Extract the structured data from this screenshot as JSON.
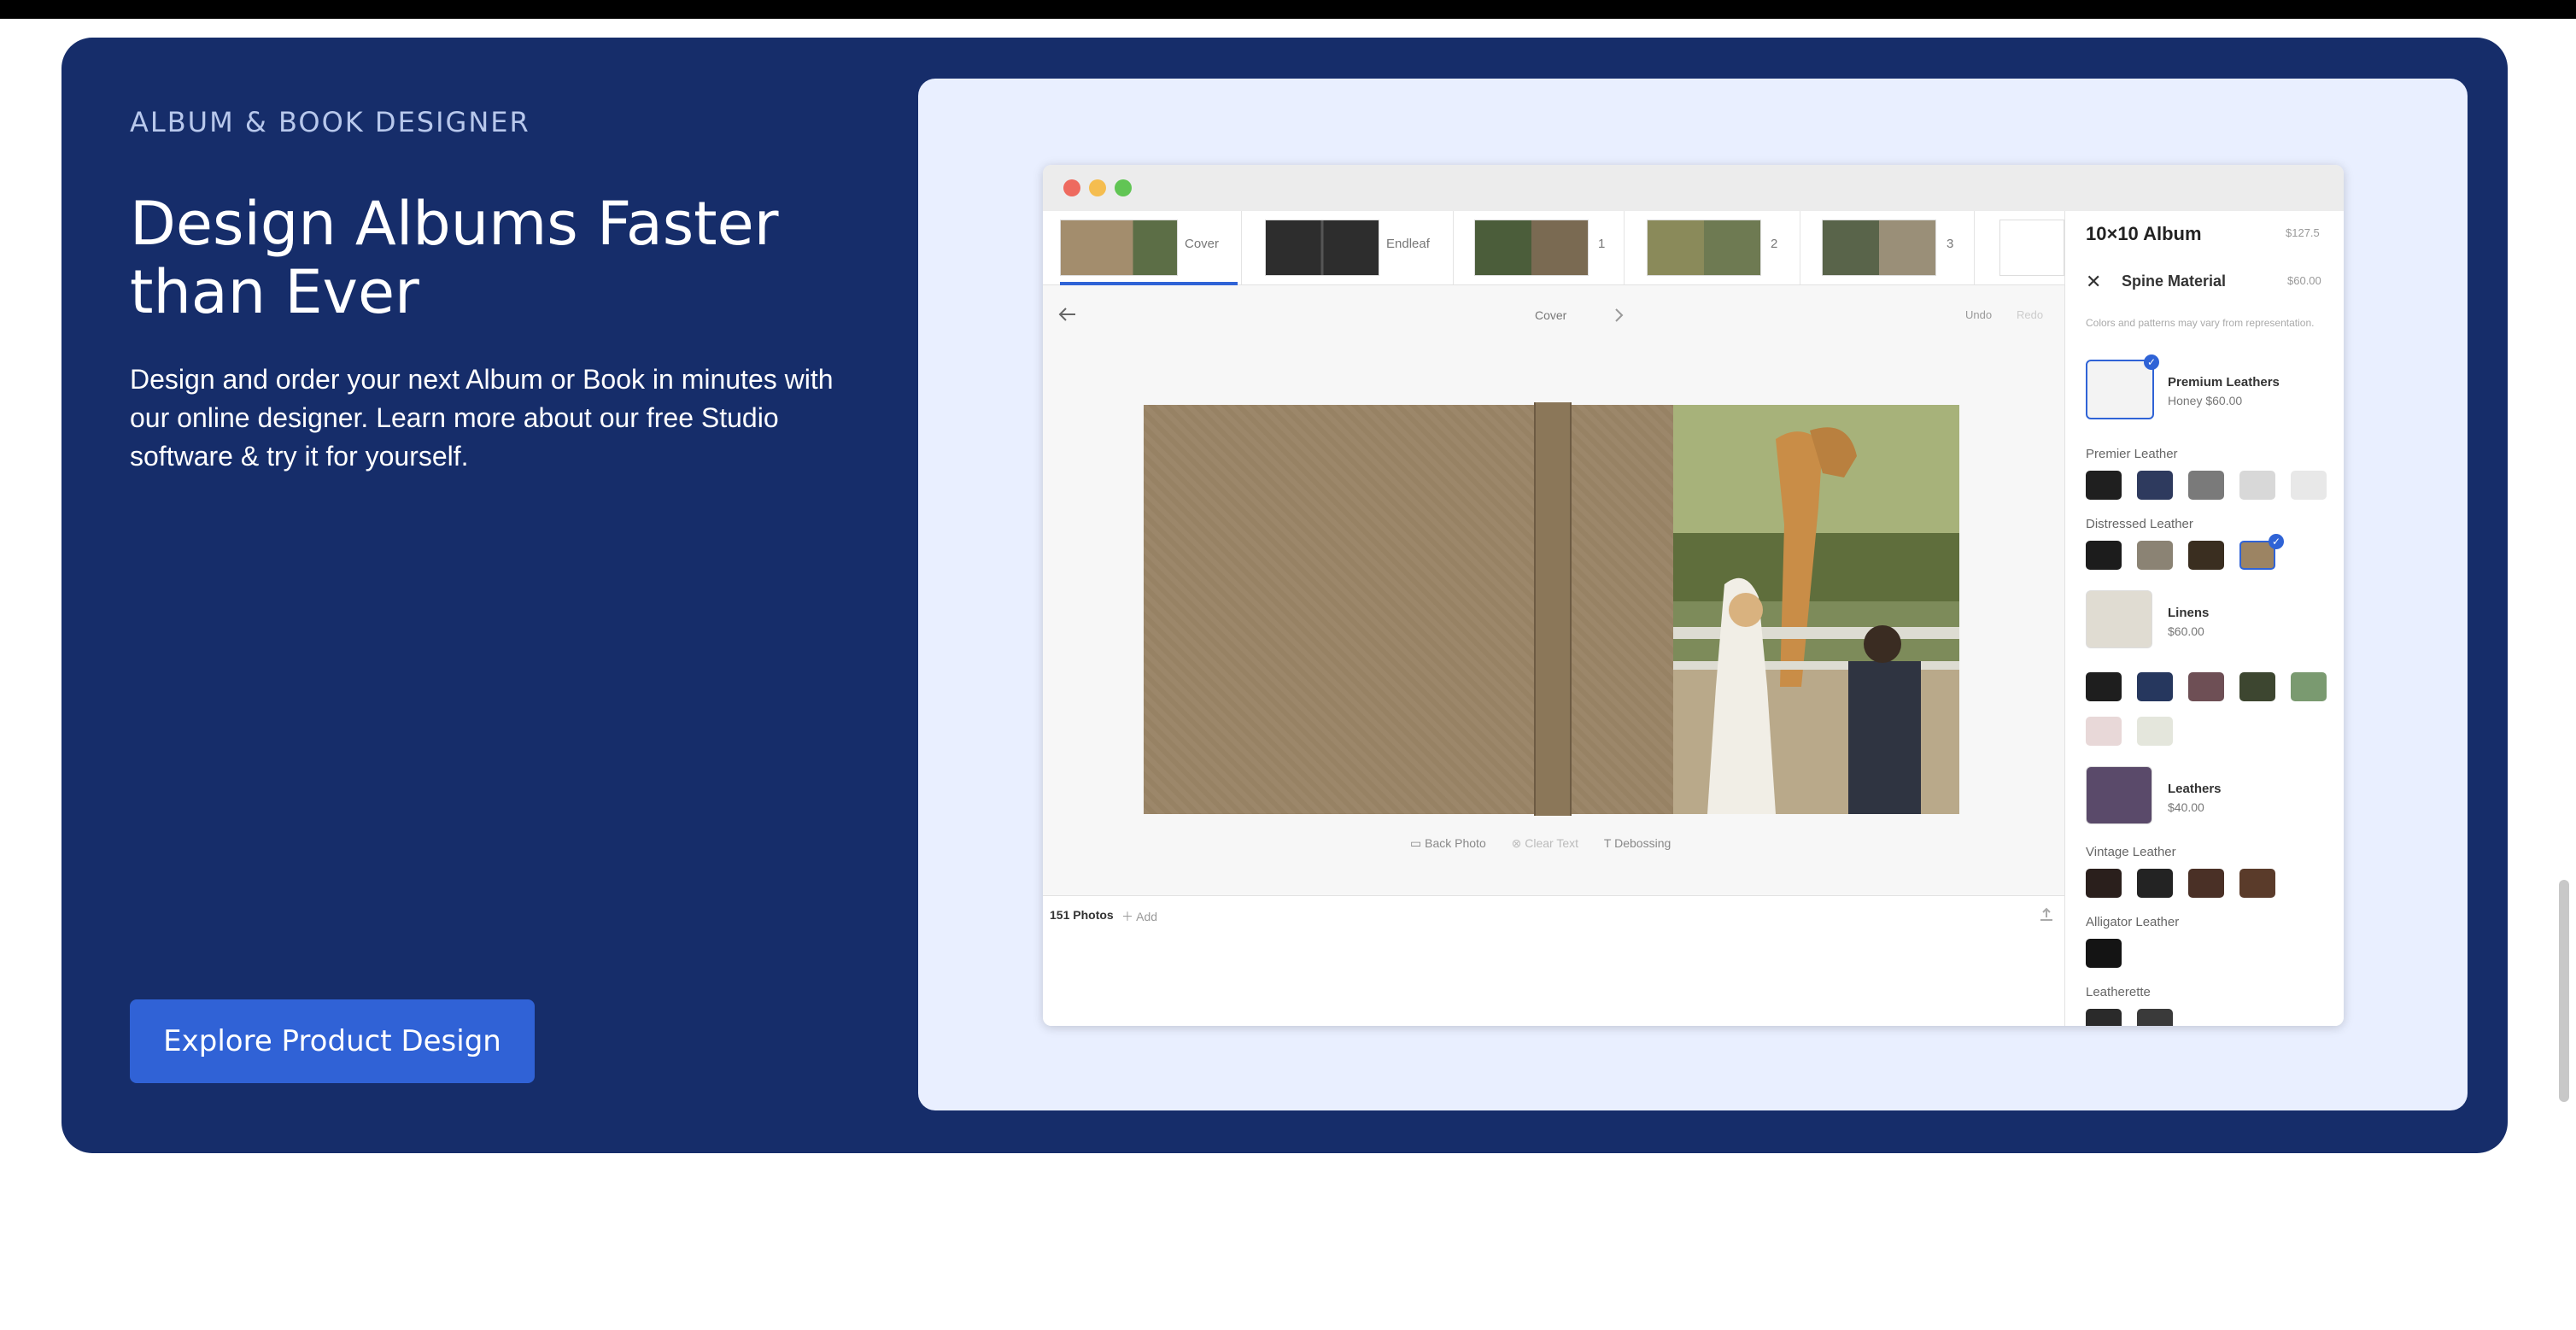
{
  "hero": {
    "eyebrow": "ALBUM & BOOK DESIGNER",
    "title": "Design Albums Faster than Ever",
    "description": "Design and order your next Album or Book in minutes with our online designer. Learn more about our free Studio software & try it for yourself.",
    "cta_label": "Explore Product Design"
  },
  "colors": {
    "hero_bg": "#162d6a",
    "panel_bg": "#e9efff",
    "cta_bg": "#3062d6",
    "accent": "#2f63d6"
  },
  "designer": {
    "pages": [
      {
        "label": "Cover",
        "active": true
      },
      {
        "label": "Endleaf"
      },
      {
        "label": "1"
      },
      {
        "label": "2"
      },
      {
        "label": "3"
      }
    ],
    "nav": {
      "back_icon": "arrow-left-icon",
      "current": "Cover",
      "next_icon": "chevron-right-icon",
      "undo": "Undo",
      "redo": "Redo"
    },
    "tools": {
      "back_photo": "Back Photo",
      "clear_text": "Clear Text",
      "debossing": "Debossing"
    },
    "photos": {
      "count_label": "151 Photos",
      "add_label": "Add"
    }
  },
  "sidebar": {
    "product": "10×10 Album",
    "product_price": "$127.5",
    "section": "Spine Material",
    "section_price": "$60.00",
    "note": "Colors and patterns may vary from representation.",
    "premium": {
      "name": "Premium Leathers",
      "detail": "Honey  $60.00"
    },
    "premier_label": "Premier Leather",
    "distressed_label": "Distressed Leather",
    "linens": {
      "name": "Linens",
      "price": "$60.00"
    },
    "leathers": {
      "name": "Leathers",
      "price": "$40.00"
    },
    "vintage_label": "Vintage Leather",
    "alligator_label": "Alligator Leather",
    "leatherette_label": "Leatherette"
  }
}
